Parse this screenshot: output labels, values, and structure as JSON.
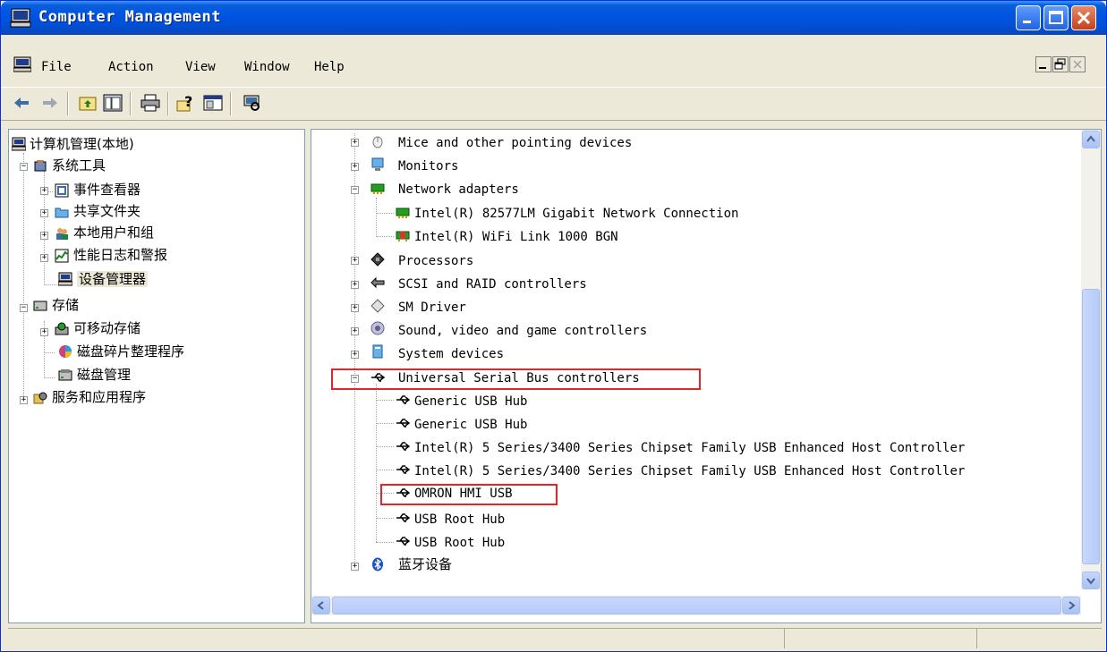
{
  "window": {
    "title": "Computer Management"
  },
  "menu": {
    "items": [
      "File",
      "Action",
      "View",
      "Window",
      "Help"
    ]
  },
  "left_tree": [
    "计算机管理(本地)",
    "系统工具",
    "事件查看器",
    "共享文件夹",
    "本地用户和组",
    "性能日志和警报",
    "设备管理器",
    "存储",
    "可移动存储",
    "磁盘碎片整理程序",
    "磁盘管理",
    "服务和应用程序"
  ],
  "device_tree": [
    "Mice and other pointing devices",
    "Monitors",
    "Network adapters",
    "Intel(R) 82577LM Gigabit Network Connection",
    "Intel(R) WiFi Link 1000 BGN",
    "Processors",
    "SCSI and RAID controllers",
    "SM Driver",
    "Sound, video and game controllers",
    "System devices",
    "Universal Serial Bus controllers",
    "Generic USB Hub",
    "Generic USB Hub",
    "Intel(R) 5 Series/3400 Series Chipset Family USB Enhanced Host Controller",
    "Intel(R) 5 Series/3400 Series Chipset Family USB Enhanced Host Controller",
    "OMRON HMI USB",
    "USB Root Hub",
    "USB Root Hub",
    "蓝牙设备"
  ],
  "colors": {
    "title_bar": "#0054e3",
    "highlight_box": "#e0262b",
    "pane_border": "#7f9db9"
  },
  "icons": {
    "title": "computer-management-icon",
    "toolbar": [
      "back-arrow-icon",
      "forward-arrow-icon",
      "up-folder-icon",
      "show-hide-tree-icon",
      "print-icon",
      "help-icon",
      "properties-icon",
      "scan-hardware-icon"
    ]
  }
}
